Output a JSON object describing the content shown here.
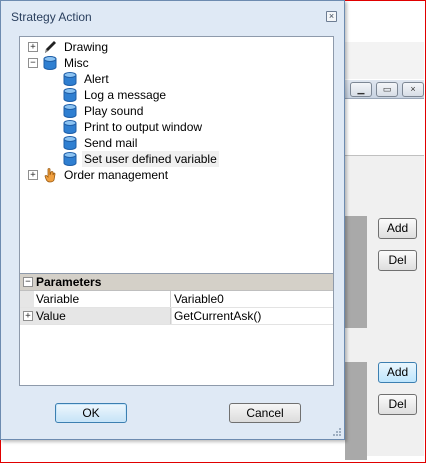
{
  "dialog": {
    "title": "Strategy Action",
    "close_glyph": "×",
    "ok_label": "OK",
    "cancel_label": "Cancel"
  },
  "tree": {
    "nodes": [
      {
        "label": "Drawing",
        "icon": "pencil-icon",
        "expander": "+"
      },
      {
        "label": "Misc",
        "icon": "database-icon",
        "expander": "−"
      },
      {
        "label": "Alert",
        "icon": "database-icon"
      },
      {
        "label": "Log a message",
        "icon": "database-icon"
      },
      {
        "label": "Play sound",
        "icon": "database-icon"
      },
      {
        "label": "Print to output window",
        "icon": "database-icon"
      },
      {
        "label": "Send mail",
        "icon": "database-icon"
      },
      {
        "label": "Set user defined variable",
        "icon": "database-icon",
        "selected": true
      },
      {
        "label": "Order management",
        "icon": "hand-icon",
        "expander": "+"
      }
    ]
  },
  "properties": {
    "section_label": "Parameters",
    "section_expander": "−",
    "rows": [
      {
        "name": "Variable",
        "value": "Variable0"
      },
      {
        "name": "Value",
        "value": "GetCurrentAsk()",
        "expander": "+"
      }
    ]
  },
  "background": {
    "buttons": [
      "Add",
      "Del",
      "Add",
      "Del"
    ]
  },
  "colors": {
    "dialog_bg": "#dfe9f5",
    "title_text": "#2a3f5e",
    "window_frame": "#e00000",
    "panel_gray": "#a9a9a9"
  }
}
